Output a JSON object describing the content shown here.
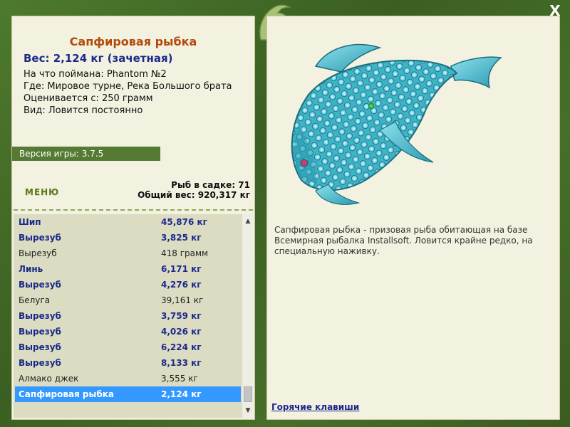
{
  "colors": {
    "frame_green": "#3e6424",
    "panel_bg": "#f3f1df",
    "title_orange": "#b44a0c",
    "bold_blue": "#1b2a8a",
    "selection_blue": "#3399ff",
    "version_bar": "#557a33"
  },
  "window": {
    "close_label": "X"
  },
  "fish_info": {
    "title": "Сапфировая рыбка",
    "weight": "Вес: 2,124 кг (зачетная)",
    "caught_on": "На что поймана: Phantom №2",
    "location": "Где: Мировое турне, Река Большого брата",
    "valued_from": "Оценивается с: 250 грамм",
    "kind": "Вид: Ловится постоянно"
  },
  "version": "Версия игры: 3.7.5",
  "menu": {
    "label": "МЕНЮ"
  },
  "stats": {
    "fish_in_net": "Рыб в садке: 71",
    "total_weight": "Общий вес: 920,317 кг"
  },
  "catch_list": [
    {
      "name": "Шип",
      "weight": "45,876 кг",
      "style": "bold"
    },
    {
      "name": "Вырезуб",
      "weight": "3,825 кг",
      "style": "bold"
    },
    {
      "name": "Вырезуб",
      "weight": "418 грамм",
      "style": "plain"
    },
    {
      "name": "Линь",
      "weight": "6,171 кг",
      "style": "bold"
    },
    {
      "name": "Вырезуб",
      "weight": "4,276 кг",
      "style": "bold"
    },
    {
      "name": "Белуга",
      "weight": "39,161 кг",
      "style": "plain"
    },
    {
      "name": "Вырезуб",
      "weight": "3,759 кг",
      "style": "bold"
    },
    {
      "name": "Вырезуб",
      "weight": "4,026 кг",
      "style": "bold"
    },
    {
      "name": "Вырезуб",
      "weight": "6,224 кг",
      "style": "bold"
    },
    {
      "name": "Вырезуб",
      "weight": "8,133 кг",
      "style": "bold"
    },
    {
      "name": "Алмако джек",
      "weight": "3,555 кг",
      "style": "plain"
    },
    {
      "name": "Сапфировая рыбка",
      "weight": "2,124 кг",
      "style": "selected"
    }
  ],
  "description": "Сапфировая рыбка - призовая рыба обитающая на базе Всемирная рыбалка Installsoft. Ловится крайне редко, на специальную наживку.",
  "hotkeys_label": "Горячие клавиши",
  "icons": {
    "close": "close-icon",
    "logo": "dolphin-logo-icon",
    "scroll_up": "scroll-up-icon",
    "scroll_down": "scroll-down-icon"
  }
}
